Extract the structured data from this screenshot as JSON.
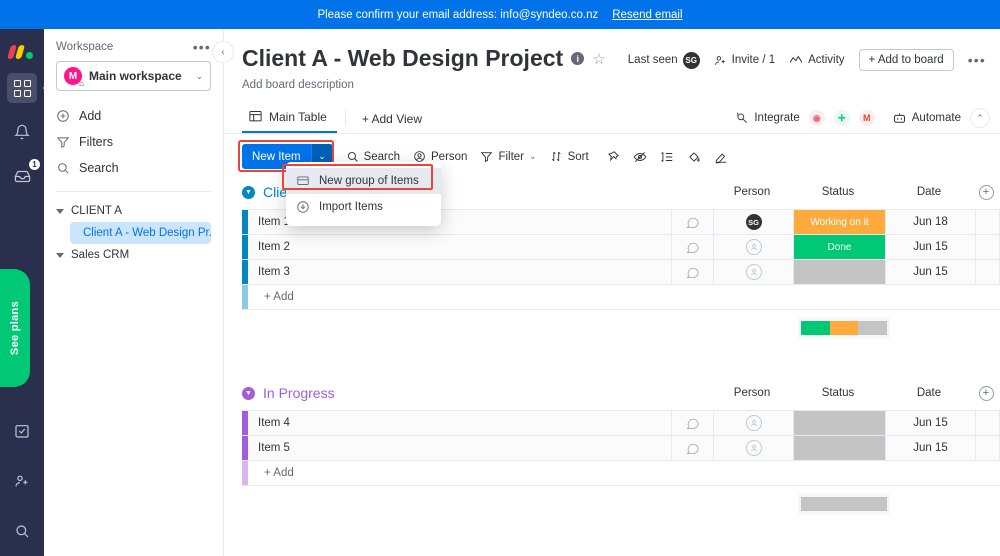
{
  "banner": {
    "message": "Please confirm your email address: info@syndeo.co.nz",
    "link_label": "Resend email"
  },
  "rail": {
    "logo_name": "monday-logo",
    "items": [
      {
        "name": "apps-grid",
        "label": ""
      },
      {
        "name": "notifications-bell",
        "label": ""
      },
      {
        "name": "inbox",
        "label": "",
        "badge": "1"
      }
    ],
    "see_plans_label": "See plans",
    "bottom_items": [
      {
        "name": "my-work",
        "label": ""
      },
      {
        "name": "invite-members",
        "label": ""
      },
      {
        "name": "search",
        "label": ""
      }
    ]
  },
  "sidebar": {
    "workspace_label": "Workspace",
    "more_label": "•••",
    "workspace_name": "Main workspace",
    "workspace_initial": "M",
    "nav": [
      {
        "label": "Add",
        "icon": "plus-circle-icon"
      },
      {
        "label": "Filters",
        "icon": "filter-icon"
      },
      {
        "label": "Search",
        "icon": "search-icon"
      }
    ],
    "tree": [
      {
        "label": "CLIENT A",
        "type": "folder"
      },
      {
        "label": "Client A - Web Design Pr...",
        "type": "board",
        "selected": true
      },
      {
        "label": "Sales CRM",
        "type": "folder"
      }
    ]
  },
  "header": {
    "title": "Client A - Web Design Project",
    "info_glyph": "i",
    "star_glyph": "☆",
    "description_placeholder": "Add board description",
    "last_seen_label": "Last seen",
    "last_seen_initials": "SG",
    "invite_label": "Invite / 1",
    "activity_label": "Activity",
    "add_to_board_label": "+ Add to board",
    "more_label": "•••"
  },
  "tabs": {
    "items": [
      {
        "label": "Main Table",
        "active": true
      },
      {
        "label": "+ Add View",
        "active": false
      }
    ],
    "integrate_label": "Integrate",
    "automate_label": "Automate",
    "app_icons": [
      {
        "name": "integration-app-1",
        "glyph": "◉",
        "color": "#e8697d",
        "bg": "#fdeef0"
      },
      {
        "name": "integration-app-2",
        "glyph": "✛",
        "color": "#00c875",
        "bg": "#eafaf3"
      },
      {
        "name": "gmail-icon",
        "glyph": "M",
        "color": "#ea4335",
        "bg": "#fdeeec"
      }
    ]
  },
  "toolbar": {
    "new_item_label": "New Item",
    "new_item_caret": "⌄",
    "search_label": "Search",
    "person_label": "Person",
    "filter_label": "Filter",
    "filter_caret": "⌄",
    "sort_label": "Sort",
    "icons": [
      {
        "name": "pin-icon"
      },
      {
        "name": "hide-icon"
      },
      {
        "name": "row-height-icon"
      },
      {
        "name": "color-fill-icon"
      },
      {
        "name": "highlighter-icon"
      }
    ]
  },
  "menu": {
    "items": [
      {
        "label": "New group of Items",
        "icon": "group-icon",
        "selected": true
      },
      {
        "label": "Import Items",
        "icon": "import-icon",
        "selected": false
      }
    ]
  },
  "board": {
    "columns": [
      "Person",
      "Status",
      "Date"
    ],
    "add_column_glyph": "+",
    "add_row_label": "+ Add",
    "groups": [
      {
        "name": "Client P",
        "color": "#0086c0",
        "rows": [
          {
            "name": "Item 1",
            "person": "SG",
            "status": "Working on it",
            "status_color": "#fdab3d",
            "date": "Jun 18"
          },
          {
            "name": "Item 2",
            "person": "",
            "status": "Done",
            "status_color": "#00c875",
            "date": "Jun 15"
          },
          {
            "name": "Item 3",
            "person": "",
            "status": "",
            "status_color": "#c4c4c4",
            "date": "Jun 15"
          }
        ],
        "summary": [
          {
            "color": "#00c875",
            "pct": 33.3
          },
          {
            "color": "#fdab3d",
            "pct": 33.3
          },
          {
            "color": "#c4c4c4",
            "pct": 33.4
          }
        ]
      },
      {
        "name": "In Progress",
        "color": "#a25ddc",
        "rows": [
          {
            "name": "Item 4",
            "person": "",
            "status": "",
            "status_color": "#c4c4c4",
            "date": "Jun 15"
          },
          {
            "name": "Item 5",
            "person": "",
            "status": "",
            "status_color": "#c4c4c4",
            "date": "Jun 15"
          }
        ],
        "summary": [
          {
            "color": "#c4c4c4",
            "pct": 100
          }
        ]
      }
    ]
  }
}
